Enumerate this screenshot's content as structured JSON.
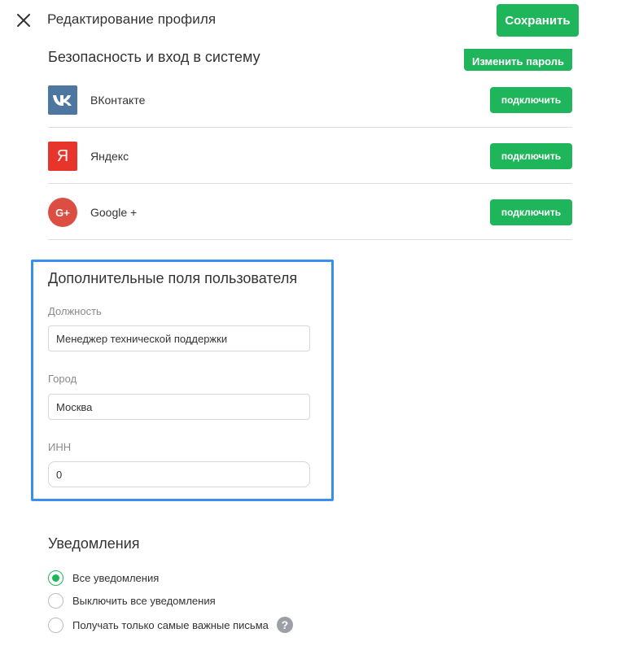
{
  "header": {
    "title": "Редактирование профиля",
    "save_label": "Сохранить"
  },
  "security": {
    "title": "Безопасность и вход в систему",
    "change_password_label": "Изменить пароль"
  },
  "social": [
    {
      "name": "ВКонтакте",
      "icon": "vk-icon",
      "color": "#4d76a1",
      "button": "подключить"
    },
    {
      "name": "Яндекс",
      "icon": "yandex-icon",
      "color": "#e8352b",
      "button": "подключить"
    },
    {
      "name": "Google +",
      "icon": "google-plus-icon",
      "color": "#dc4e41",
      "button": "подключить"
    }
  ],
  "extra_fields": {
    "title": "Дополнительные поля пользователя",
    "fields": [
      {
        "label": "Должность",
        "value": "Менеджер технической поддержки"
      },
      {
        "label": "Город",
        "value": "Москва"
      },
      {
        "label": "ИНН",
        "value": "0"
      }
    ]
  },
  "notifications": {
    "title": "Уведомления",
    "options": [
      {
        "label": "Все уведомления",
        "checked": true
      },
      {
        "label": "Выключить все уведомления",
        "checked": false
      },
      {
        "label": "Получать только самые важные письма",
        "checked": false
      }
    ]
  },
  "colors": {
    "accent": "#1fb55b",
    "highlight_border": "#3a8ef0"
  }
}
